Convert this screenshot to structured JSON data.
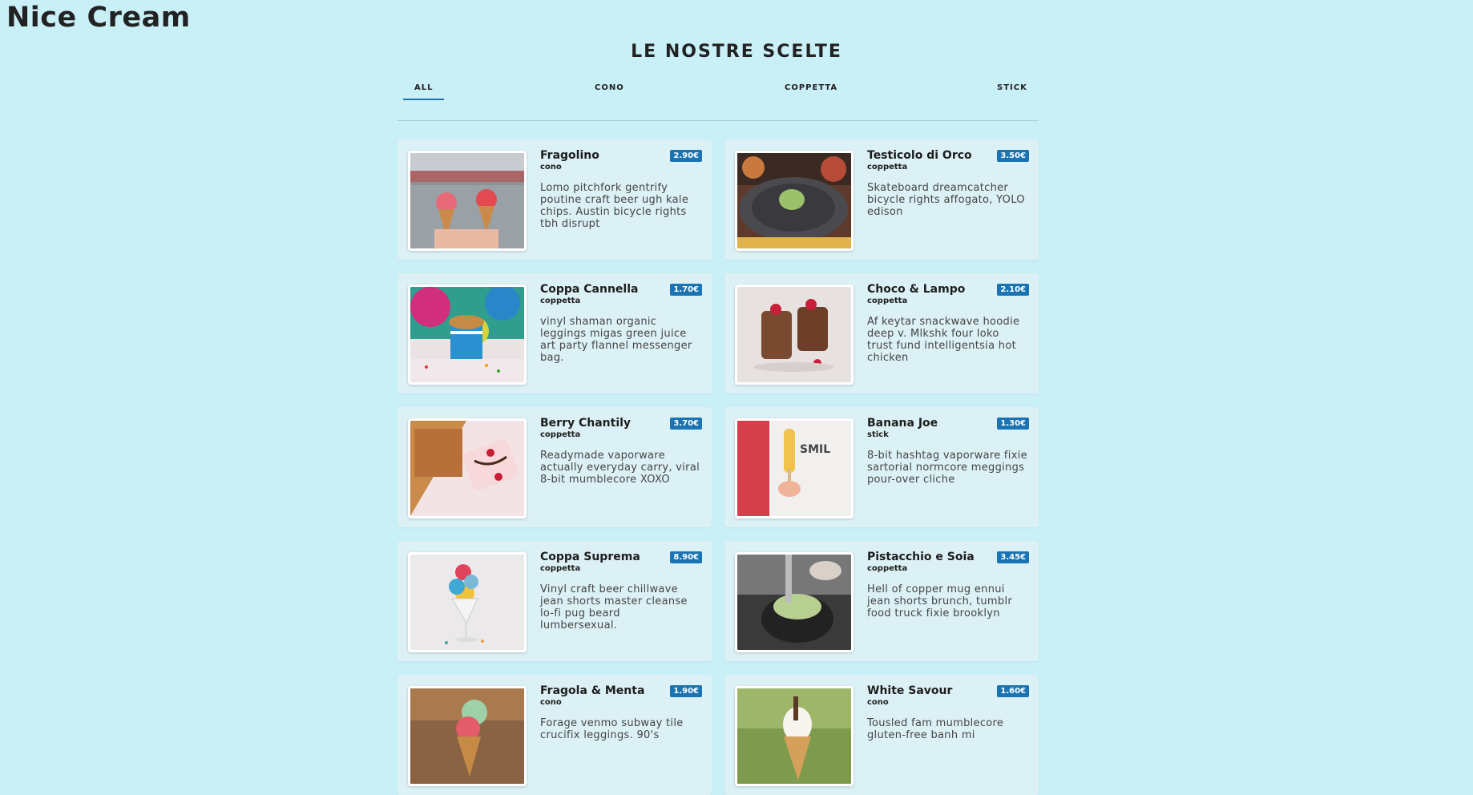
{
  "site": {
    "title": "Nice Cream"
  },
  "section": {
    "title": "LE NOSTRE SCELTE"
  },
  "tabs": [
    {
      "label": "ALL",
      "active": true
    },
    {
      "label": "CONO",
      "active": false
    },
    {
      "label": "COPPETTA",
      "active": false
    },
    {
      "label": "STICK",
      "active": false
    }
  ],
  "colors": {
    "background": "#c9eff7",
    "accent": "#1a74b3",
    "card": "#dcf1f5"
  },
  "products": [
    {
      "name": "Fragolino",
      "category": "cono",
      "price": "2.90€",
      "description": "Lomo pitchfork gentrify poutine craft beer ugh kale chips. Austin bicycle rights tbh disrupt",
      "image": "strawberry-cones-photo"
    },
    {
      "name": "Testicolo di Orco",
      "category": "coppetta",
      "price": "3.50€",
      "description": "Skateboard dreamcatcher bicycle rights affogato, YOLO edison",
      "image": "green-scoop-plate-photo"
    },
    {
      "name": "Coppa Cannella",
      "category": "coppetta",
      "price": "1.70€",
      "description": "vinyl shaman organic leggings migas green juice art party flannel messenger bag.",
      "image": "blue-cup-sprinkles-photo"
    },
    {
      "name": "Choco & Lampo",
      "category": "coppetta",
      "price": "2.10€",
      "description": "Af keytar snackwave hoodie deep v. Mlkshk four loko trust fund intelligentsia hot chicken",
      "image": "chocolate-cups-photo"
    },
    {
      "name": "Berry Chantily",
      "category": "coppetta",
      "price": "3.70€",
      "description": "Readymade vaporware actually everyday carry, viral 8-bit mumblecore XOXO",
      "image": "berry-dessert-tray-photo"
    },
    {
      "name": "Banana Joe",
      "category": "stick",
      "price": "1.30€",
      "description": "8-bit hashtag vaporware fixie sartorial normcore meggings pour-over cliche",
      "image": "popsicle-hand-photo"
    },
    {
      "name": "Coppa Suprema",
      "category": "coppetta",
      "price": "8.90€",
      "description": "Vinyl craft beer chillwave jean shorts master cleanse lo-fi pug beard lumbersexual.",
      "image": "colorful-scoops-glass-photo"
    },
    {
      "name": "Pistacchio e Soia",
      "category": "coppetta",
      "price": "3.45€",
      "description": "Hell of copper mug ennui jean shorts brunch, tumblr food truck fixie brooklyn",
      "image": "pistachio-bowl-photo"
    },
    {
      "name": "Fragola & Menta",
      "category": "cono",
      "price": "1.90€",
      "description": "Forage venmo subway tile crucifix leggings. 90's",
      "image": "strawberry-mint-cone-photo"
    },
    {
      "name": "White Savour",
      "category": "cono",
      "price": "1.60€",
      "description": "Tousled fam mumblecore gluten-free banh mi",
      "image": "soft-serve-cone-photo"
    }
  ]
}
